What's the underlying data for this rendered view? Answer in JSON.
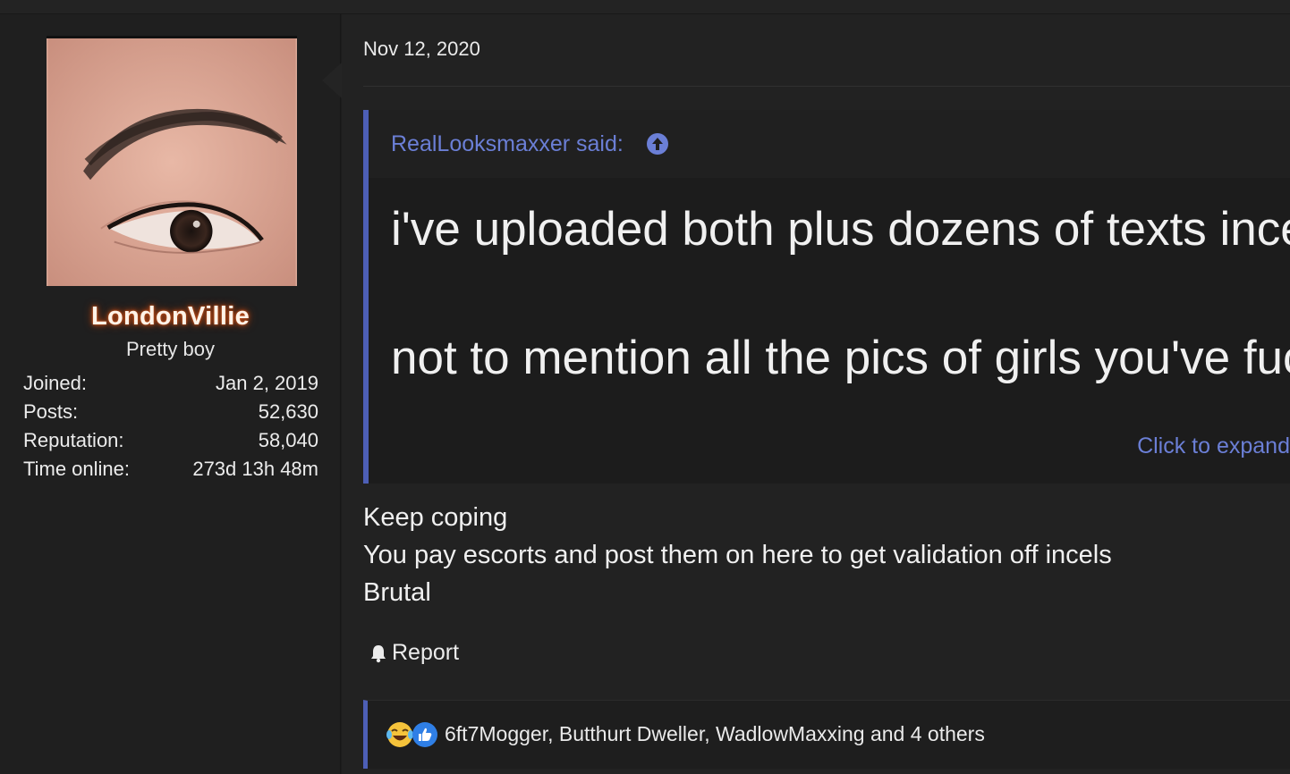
{
  "post": {
    "date": "Nov 12, 2020"
  },
  "user": {
    "name": "LondonVillie",
    "title": "Pretty boy",
    "stats": [
      {
        "label": "Joined:",
        "value": "Jan 2, 2019"
      },
      {
        "label": "Posts:",
        "value": "52,630"
      },
      {
        "label": "Reputation:",
        "value": "58,040"
      },
      {
        "label": "Time online:",
        "value": "273d 13h 48m"
      }
    ]
  },
  "quote": {
    "author": "RealLooksmaxxer said:",
    "line1": "i've uploaded both plus dozens of texts ince",
    "line2": "not to mention all the pics of girls you've fuc",
    "expand": "Click to expand"
  },
  "body": {
    "lines": [
      "Keep coping",
      "You pay escorts and post them on here to get validation off incels",
      "Brutal"
    ]
  },
  "actions": {
    "report": "Report"
  },
  "reactions": {
    "text": "6ft7Mogger, Butthurt Dweller, WadlowMaxxing and 4 others",
    "icons": [
      "laughing-crying-icon",
      "thumbs-up-icon"
    ]
  },
  "colors": {
    "accent": "#4d5fb6",
    "link": "#6b7fd6",
    "username_glow": "#c04a16"
  }
}
